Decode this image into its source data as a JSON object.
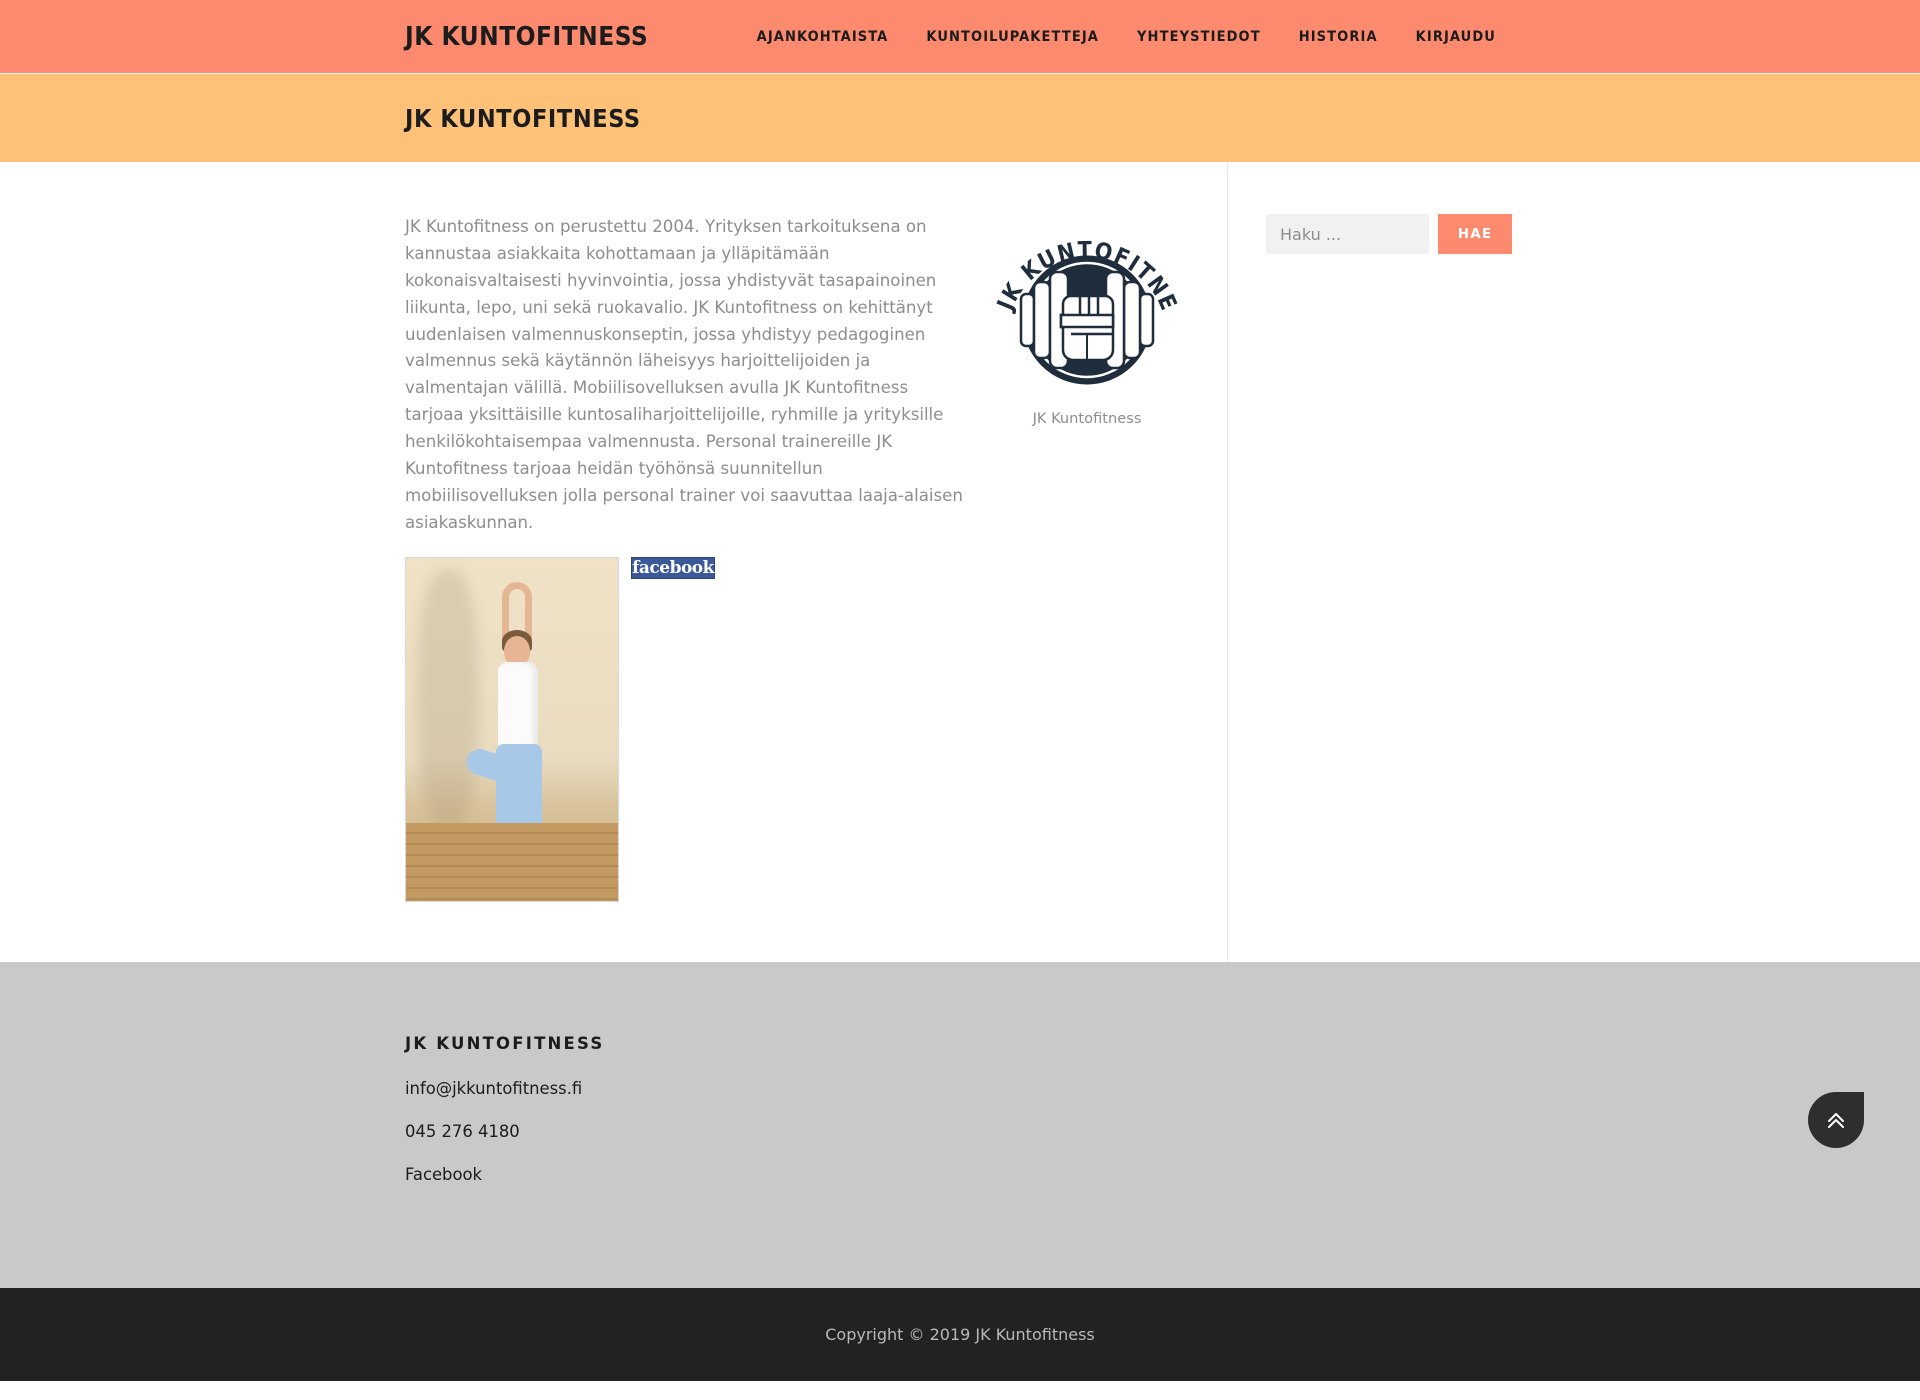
{
  "header": {
    "brand": "JK Kuntofitness",
    "nav": [
      {
        "label": "Ajankohtaista",
        "name": "nav-ajankohtaista"
      },
      {
        "label": "Kuntoilupaketteja",
        "name": "nav-kuntoilupaketteja"
      },
      {
        "label": "Yhteystiedot",
        "name": "nav-yhteystiedot"
      },
      {
        "label": "Historia",
        "name": "nav-historia"
      },
      {
        "label": "Kirjaudu",
        "name": "nav-kirjaudu"
      }
    ]
  },
  "banner": {
    "title": "JK Kuntofitness"
  },
  "main": {
    "intro_paragraph": "JK Kuntofitness on perustettu 2004. Yrityksen tarkoituksena on kannustaa asiakkaita kohottamaan ja ylläpitämään kokonaisvaltaisesti hyvinvointia, jossa yhdistyvät tasapainoinen liikunta, lepo, uni sekä ruokavalio. JK Kuntofitness on kehittänyt uudenlaisen valmennuskonseptin, jossa yhdistyy pedagoginen valmennus sekä käytännön läheisyys harjoittelijoiden ja valmentajan välillä. Mobiilisovelluksen avulla JK Kuntofitness tarjoaa yksittäisille kuntosaliharjoittelijoille, ryhmille ja yrityksille henkilökohtaisempaa valmennusta. Personal trainereille JK Kuntofitness tarjoaa heidän työhönsä suunnitellun mobiilisovelluksen jolla personal trainer voi saavuttaa laaja-alaisen asiakaskunnan.",
    "logo_caption": "JK Kuntofitness",
    "logo_text": "JK KUNTOFITNESS",
    "facebook_badge": "facebook",
    "photo_alt": "yoga-pose-photo"
  },
  "sidebar": {
    "search_placeholder": "Haku ...",
    "search_value": "",
    "search_button": "Hae"
  },
  "footer": {
    "heading": "JK Kuntofitness",
    "email": "info@jkkuntofitness.fi",
    "phone": "045 276 4180",
    "facebook": "Facebook",
    "copyright": "Copyright © 2019 JK Kuntofitness"
  },
  "colors": {
    "header_bg": "#fb8a6f",
    "banner_bg": "#fdc277",
    "accent": "#fb8a6f",
    "footer_top_bg": "#c9c9c9",
    "footer_bottom_bg": "#222222",
    "body_text": "#8d8d8d",
    "logo_navy": "#1f2d3d",
    "facebook_blue": "#3b5998"
  }
}
